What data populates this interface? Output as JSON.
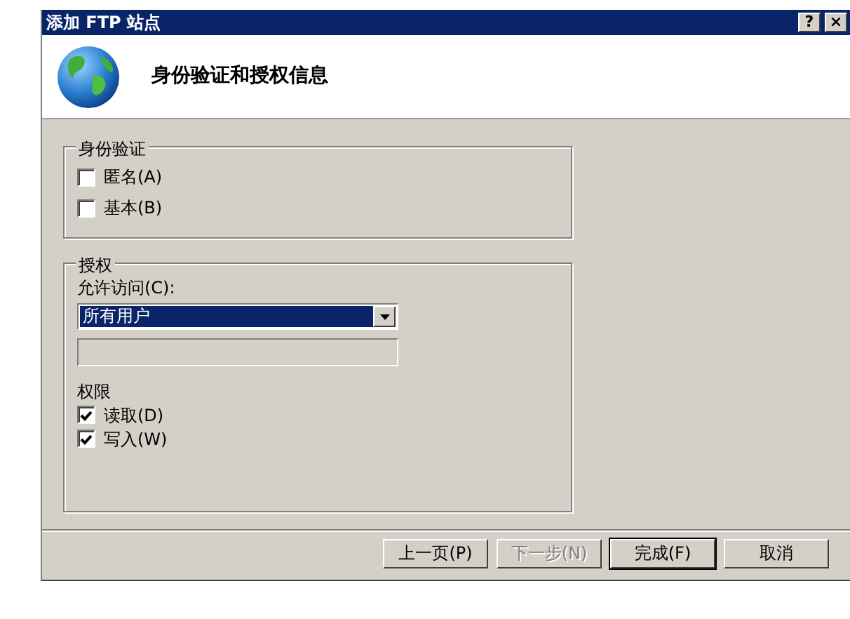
{
  "window": {
    "title": "添加 FTP 站点",
    "buttons": [
      "?",
      "×"
    ]
  },
  "header": {
    "title": "身份验证和授权信息"
  },
  "authentication": {
    "legend": "身份验证",
    "options": [
      {
        "label": "匿名(A)",
        "checked": false
      },
      {
        "label": "基本(B)",
        "checked": false
      }
    ]
  },
  "authorization": {
    "legend": "授权",
    "access_label": "允许访问(C):",
    "access_value": "所有用户",
    "permissions_label": "权限",
    "permissions": [
      {
        "label": "读取(D)",
        "checked": true
      },
      {
        "label": "写入(W)",
        "checked": true
      }
    ]
  },
  "buttons": [
    {
      "label": "上一页(P)",
      "disabled": false,
      "default": false
    },
    {
      "label": "下一步(N)",
      "disabled": true,
      "default": false
    },
    {
      "label": "完成(F)",
      "disabled": false,
      "default": true
    },
    {
      "label": "取消",
      "disabled": false,
      "default": false
    }
  ]
}
